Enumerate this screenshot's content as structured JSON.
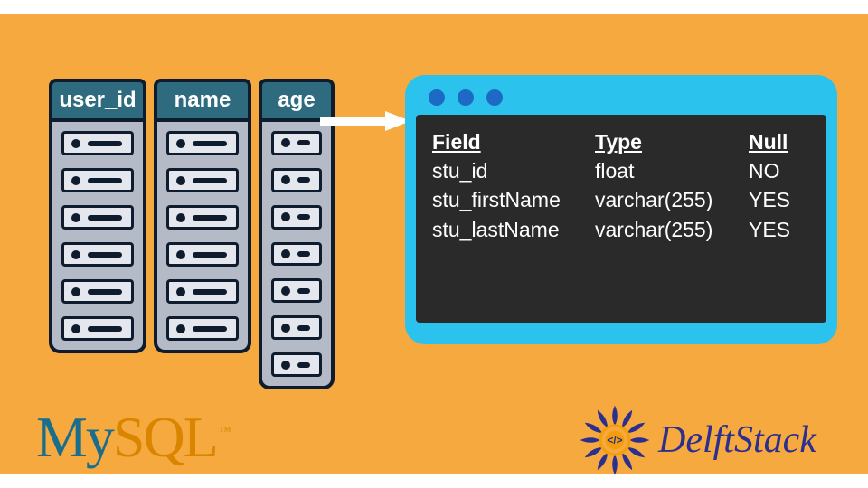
{
  "columns": {
    "c1": "user_id",
    "c2": "name",
    "c3": "age"
  },
  "window": {
    "header": {
      "field": "Field",
      "type": "Type",
      "null": "Null"
    },
    "rows": [
      {
        "field": "stu_id",
        "type": "float",
        "null": "NO"
      },
      {
        "field": "stu_firstName",
        "type": "varchar(255)",
        "null": "YES"
      },
      {
        "field": "stu_lastName",
        "type": "varchar(255)",
        "null": "YES"
      }
    ]
  },
  "logos": {
    "mysql_my": "My",
    "mysql_sql": "SQL",
    "mysql_tm": "™",
    "delft": "DelftStack"
  }
}
